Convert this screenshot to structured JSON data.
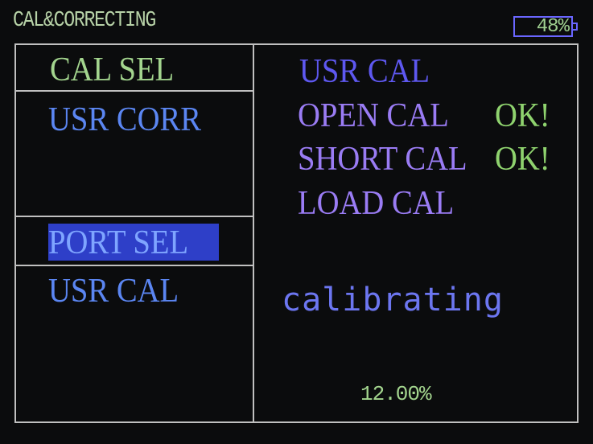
{
  "header": {
    "title": "CAL&CORRECTING",
    "battery": "48%"
  },
  "left_menu": {
    "cal_sel_label": "CAL SEL",
    "cal_sel_value": "USR CORR",
    "port_sel_label": "PORT SEL",
    "port_sel_value": "USR CAL"
  },
  "right_panel": {
    "mode": "USR CAL",
    "steps": [
      {
        "label": "OPEN CAL",
        "status": "OK!"
      },
      {
        "label": "SHORT CAL",
        "status": "OK!"
      },
      {
        "label": "LOAD CAL",
        "status": ""
      }
    ],
    "status_text": "calibrating",
    "progress": "12.00%"
  },
  "colors": {
    "label_green": "#a3d58e",
    "value_blue": "#5b86f2",
    "step_purple": "#9a7cf4",
    "highlight": "#2e3fc8",
    "border": "#c0c0c0"
  }
}
